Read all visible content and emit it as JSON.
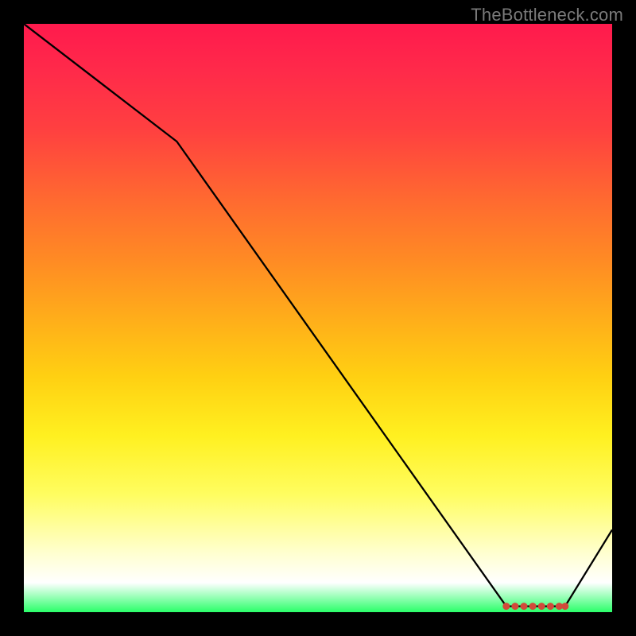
{
  "watermark": "TheBottleneck.com",
  "chart_data": {
    "type": "line",
    "title": "",
    "xlabel": "",
    "ylabel": "",
    "xlim": [
      0,
      100
    ],
    "ylim": [
      0,
      100
    ],
    "x": [
      0,
      26,
      82,
      92,
      100
    ],
    "values": [
      100,
      80,
      1,
      1,
      14
    ],
    "markers": {
      "x": [
        82,
        83.5,
        85,
        86.5,
        88,
        89.5,
        91,
        92
      ],
      "y": [
        1,
        1,
        1,
        1,
        1,
        1,
        1,
        1
      ]
    },
    "annotations": []
  },
  "colors": {
    "background": "#000000",
    "line": "#000000",
    "dot": "#d24a3a",
    "gradient_top": "#ff1a4d",
    "gradient_bottom": "#2aff6a"
  }
}
